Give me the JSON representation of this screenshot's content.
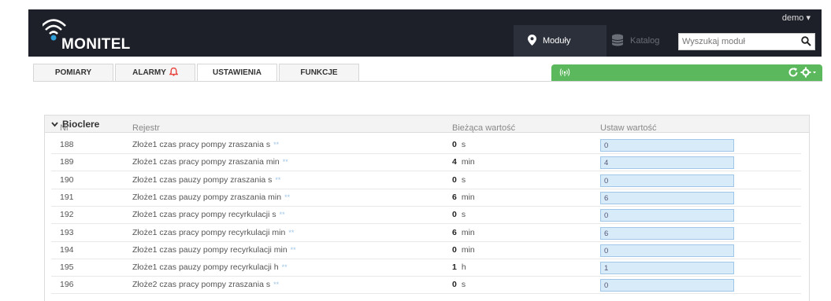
{
  "header": {
    "brand": "MONITEL",
    "user": "demo",
    "nav": [
      {
        "label": "Moduły",
        "icon": "map-pin-icon"
      },
      {
        "label": "Katalog",
        "icon": "database-icon"
      }
    ],
    "search_placeholder": "Wyszukaj moduł"
  },
  "tabs": [
    {
      "label": "POMIARY"
    },
    {
      "label": "ALARMY"
    },
    {
      "label": "USTAWIENIA"
    },
    {
      "label": "FUNKCJE"
    }
  ],
  "colors": {
    "accent_green": "#5cb85c",
    "topbar": "#1d2029",
    "alarm_red": "#e8413b"
  },
  "panel": {
    "title": "Bioclere",
    "columns": {
      "nr": "Nr",
      "register": "Rejestr",
      "current": "Bieżąca wartość",
      "set": "Ustaw wartość"
    },
    "rows": [
      {
        "nr": "188",
        "register": "Złoże1 czas pracy pompy zraszania s",
        "value": "0",
        "unit": "s",
        "set": "0"
      },
      {
        "nr": "189",
        "register": "Złoże1 czas pracy pompy zraszania min",
        "value": "4",
        "unit": "min",
        "set": "4"
      },
      {
        "nr": "190",
        "register": "Złoże1 czas pauzy pompy zraszania s",
        "value": "0",
        "unit": "s",
        "set": "0"
      },
      {
        "nr": "191",
        "register": "Złoże1 czas pauzy pompy zraszania min",
        "value": "6",
        "unit": "min",
        "set": "6"
      },
      {
        "nr": "192",
        "register": "Złoże1 czas pracy pompy recyrkulacji s",
        "value": "0",
        "unit": "s",
        "set": "0"
      },
      {
        "nr": "193",
        "register": "Złoże1 czas pracy pompy recyrkulacji min",
        "value": "6",
        "unit": "min",
        "set": "6"
      },
      {
        "nr": "194",
        "register": "Złoże1 czas pauzy pompy recyrkulacji min",
        "value": "0",
        "unit": "min",
        "set": "0"
      },
      {
        "nr": "195",
        "register": "Złoże1 czas pauzy pompy recyrkulacji h",
        "value": "1",
        "unit": "h",
        "set": "1"
      },
      {
        "nr": "196",
        "register": "Złoże2 czas pracy pompy zraszania s",
        "value": "0",
        "unit": "s",
        "set": "0"
      }
    ]
  }
}
